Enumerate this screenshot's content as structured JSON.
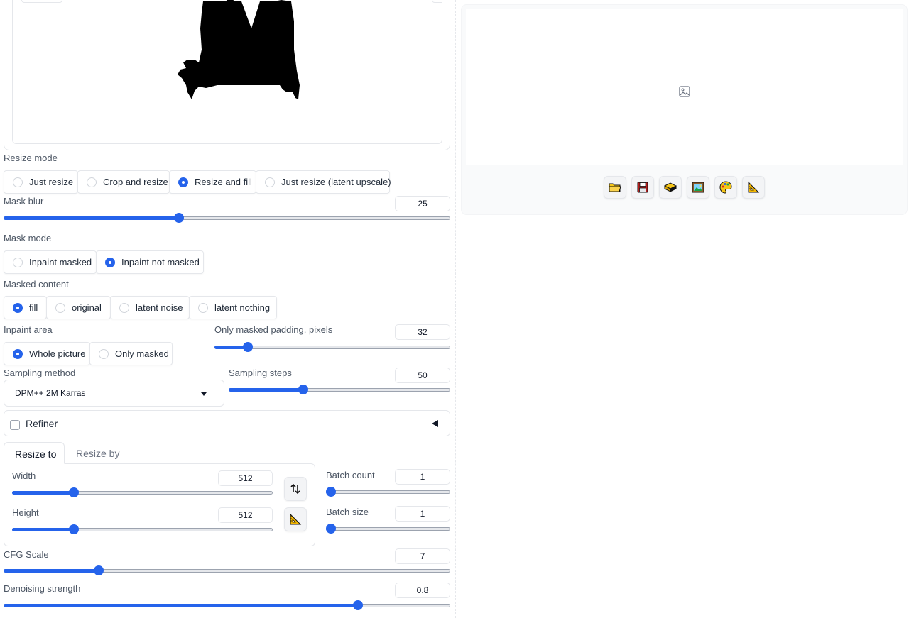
{
  "resize_mode": {
    "label": "Resize mode",
    "options": [
      "Just resize",
      "Crop and resize",
      "Resize and fill",
      "Just resize (latent upscale)"
    ],
    "selected": "Resize and fill"
  },
  "mask_blur": {
    "label": "Mask blur",
    "value": "25",
    "min": 0,
    "max": 64
  },
  "mask_mode": {
    "label": "Mask mode",
    "options": [
      "Inpaint masked",
      "Inpaint not masked"
    ],
    "selected": "Inpaint not masked"
  },
  "masked_content": {
    "label": "Masked content",
    "options": [
      "fill",
      "original",
      "latent noise",
      "latent nothing"
    ],
    "selected": "fill"
  },
  "inpaint_area": {
    "label": "Inpaint area",
    "options": [
      "Whole picture",
      "Only masked"
    ],
    "selected": "Whole picture"
  },
  "only_masked_padding": {
    "label": "Only masked padding, pixels",
    "value": "32",
    "min": 0,
    "max": 256
  },
  "sampling_method": {
    "label": "Sampling method",
    "value": "DPM++ 2M Karras"
  },
  "sampling_steps": {
    "label": "Sampling steps",
    "value": "50",
    "min": 1,
    "max": 150
  },
  "refiner": {
    "label": "Refiner",
    "checked": false
  },
  "resize_tabs": {
    "active": "Resize to",
    "inactive": "Resize by"
  },
  "width": {
    "label": "Width",
    "value": "512",
    "min": 64,
    "max": 2048
  },
  "height": {
    "label": "Height",
    "value": "512",
    "min": 64,
    "max": 2048
  },
  "batch_count": {
    "label": "Batch count",
    "value": "1",
    "min": 1,
    "max": 100
  },
  "batch_size": {
    "label": "Batch size",
    "value": "1",
    "min": 1,
    "max": 8
  },
  "cfg_scale": {
    "label": "CFG Scale",
    "value": "7",
    "min": 1,
    "max": 30
  },
  "denoising_strength": {
    "label": "Denoising strength",
    "value": "0.8",
    "min": 0,
    "max": 1
  },
  "output_toolbar": [
    "folder-icon",
    "save-icon",
    "zip-icon",
    "send-to-img2img-icon",
    "send-to-inpaint-icon",
    "send-to-extras-icon"
  ],
  "colors": {
    "accent": "#2563eb",
    "border": "#e5e7eb"
  }
}
